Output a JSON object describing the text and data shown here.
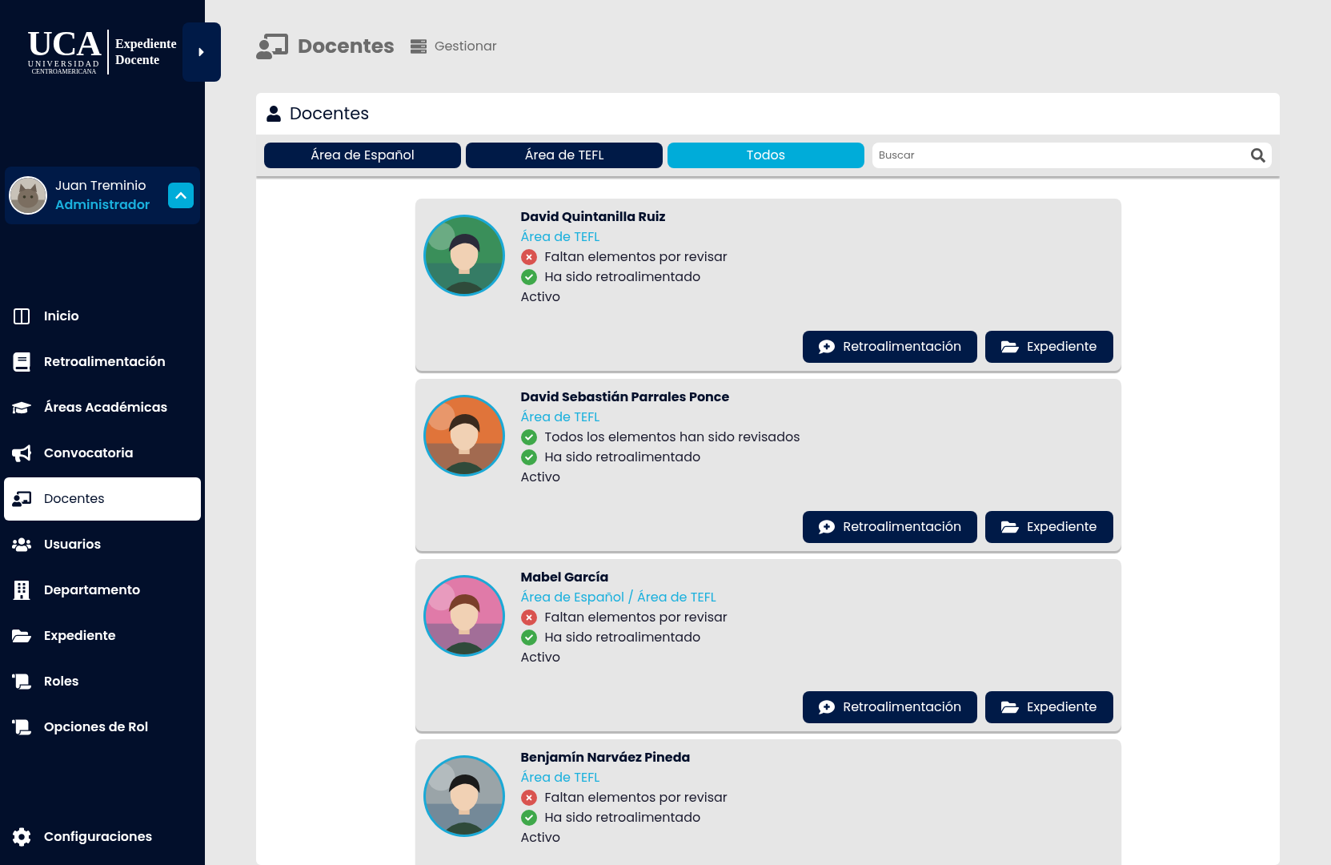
{
  "logo": {
    "mark": "UCA",
    "line_1": "UNIVERSIDAD",
    "line_2": "CENTROAMERICANA",
    "product_1": "Expediente",
    "product_2": "Docente"
  },
  "user": {
    "name": "Juan Treminio",
    "role": "Administrador",
    "expanded": true
  },
  "sidebar": {
    "items": [
      {
        "label": "Inicio",
        "selected": false
      },
      {
        "label": "Retroalimentación",
        "selected": false
      },
      {
        "label": "Áreas Académicas",
        "selected": false
      },
      {
        "label": "Convocatoria",
        "selected": false
      },
      {
        "label": "Docentes",
        "selected": true
      },
      {
        "label": "Usuarios",
        "selected": false
      },
      {
        "label": "Departamento",
        "selected": false
      },
      {
        "label": "Expediente",
        "selected": false
      },
      {
        "label": "Roles",
        "selected": false
      },
      {
        "label": "Opciones de Rol",
        "selected": false
      }
    ],
    "footer": "Configuraciones"
  },
  "header": {
    "title": "Docentes",
    "breadcrumb": "Gestionar"
  },
  "panel": {
    "title": "Docentes",
    "filters": [
      {
        "label": "Área de Español",
        "selected": false
      },
      {
        "label": "Área de TEFL",
        "selected": false
      },
      {
        "label": "Todos",
        "selected": true
      }
    ],
    "search": {
      "placeholder": "Buscar"
    }
  },
  "teachers": [
    {
      "name": "David Quintanilla Ruiz",
      "area": "Área de TEFL",
      "statuses": [
        {
          "text": "Faltan elementos por revisar",
          "done": false
        },
        {
          "text": "Ha sido retroalimentado",
          "done": true
        }
      ],
      "state": "Activo",
      "buttons": [
        "Retroalimentación",
        "Expediente"
      ]
    },
    {
      "name": "David Sebastián Parrales Ponce",
      "area": "Área de TEFL",
      "statuses": [
        {
          "text": "Todos los elementos han sido revisados",
          "done": true
        },
        {
          "text": "Ha sido retroalimentado",
          "done": true
        }
      ],
      "state": "Activo",
      "buttons": [
        "Retroalimentación",
        "Expediente"
      ]
    },
    {
      "name": "Mabel García",
      "area": "Área de Español / Área de TEFL",
      "statuses": [
        {
          "text": "Faltan elementos por revisar",
          "done": false
        },
        {
          "text": "Ha sido retroalimentado",
          "done": true
        }
      ],
      "state": "Activo",
      "buttons": [
        "Retroalimentación",
        "Expediente"
      ]
    },
    {
      "name": "Benjamín Narváez Pineda",
      "area": "Área de TEFL",
      "statuses": [
        {
          "text": "Faltan elementos por revisar",
          "done": false
        },
        {
          "text": "Ha sido retroalimentado",
          "done": true
        }
      ],
      "state": "Activo"
    }
  ]
}
